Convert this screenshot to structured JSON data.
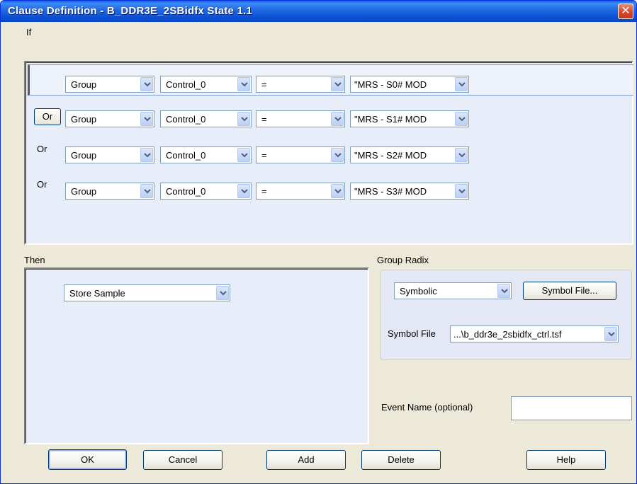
{
  "window": {
    "title": "Clause Definition -  B_DDR3E_2SBidfx State 1.1",
    "close_glyph": "✕"
  },
  "if_section": {
    "label": "If",
    "rows": [
      {
        "prefix": "",
        "group": "Group",
        "signal": "Control_0",
        "operator": "=",
        "value": "\"MRS - S0# MOD"
      },
      {
        "prefix": "Or",
        "group": "Group",
        "signal": "Control_0",
        "operator": "=",
        "value": "\"MRS - S1# MOD"
      },
      {
        "prefix": "Or",
        "group": "Group",
        "signal": "Control_0",
        "operator": "=",
        "value": "\"MRS - S2# MOD"
      },
      {
        "prefix": "Or",
        "group": "Group",
        "signal": "Control_0",
        "operator": "=",
        "value": "\"MRS - S3# MOD"
      }
    ]
  },
  "then_section": {
    "label": "Then",
    "action": "Store Sample"
  },
  "group_radix": {
    "label": "Group Radix",
    "radix": "Symbolic",
    "symbol_file_button": "Symbol File...",
    "symbol_file_label": "Symbol File",
    "symbol_file_value": "...\\b_ddr3e_2sbidfx_ctrl.tsf"
  },
  "event_name": {
    "label": "Event Name (optional)",
    "value": ""
  },
  "buttons": {
    "ok": "OK",
    "cancel": "Cancel",
    "add": "Add",
    "delete": "Delete",
    "help": "Help"
  },
  "colors": {
    "title_bar": "#0b4fd4",
    "panel_bg": "#e7eef9",
    "dialog_bg": "#ece9d8",
    "close_button": "#d9472a"
  },
  "icons": {
    "dropdown": "chevron-down-icon",
    "close": "close-icon"
  }
}
